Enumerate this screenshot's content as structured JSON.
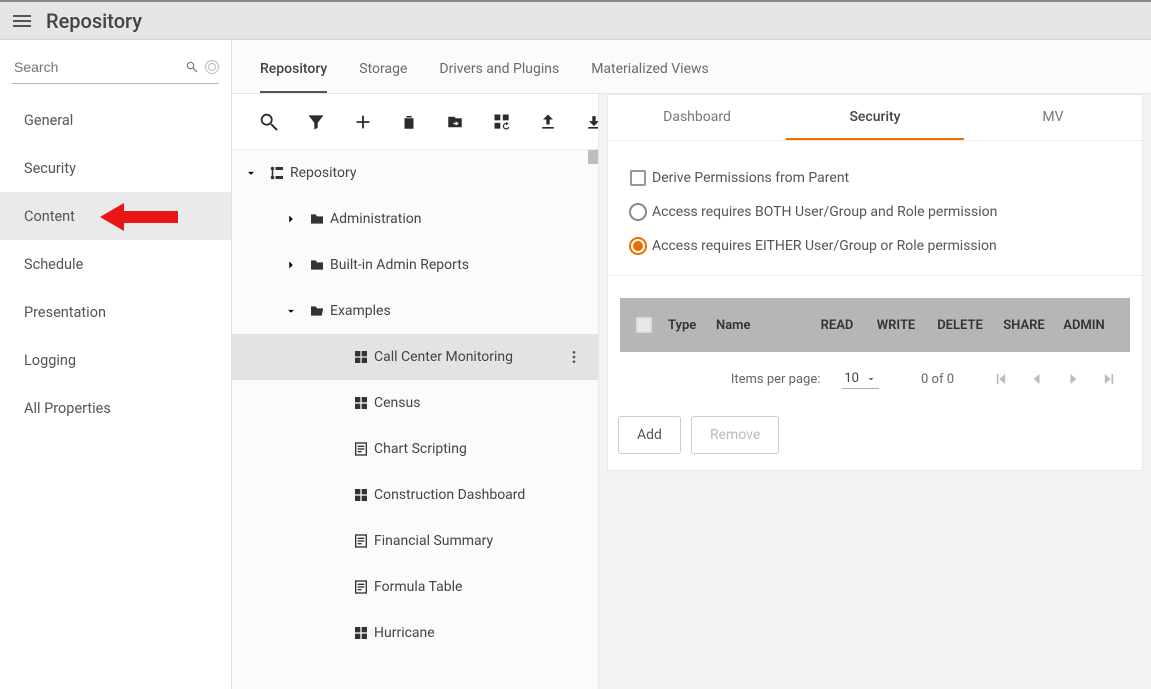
{
  "topbar": {
    "title": "Repository"
  },
  "sidebar": {
    "search_placeholder": "Search",
    "items": [
      {
        "label": "General",
        "active": false
      },
      {
        "label": "Security",
        "active": false
      },
      {
        "label": "Content",
        "active": true
      },
      {
        "label": "Schedule",
        "active": false
      },
      {
        "label": "Presentation",
        "active": false
      },
      {
        "label": "Logging",
        "active": false
      },
      {
        "label": "All Properties",
        "active": false
      }
    ]
  },
  "mid_tabs": {
    "items": [
      {
        "label": "Repository",
        "active": true
      },
      {
        "label": "Storage",
        "active": false
      },
      {
        "label": "Drivers and Plugins",
        "active": false
      },
      {
        "label": "Materialized Views",
        "active": false
      }
    ]
  },
  "tree": {
    "root": {
      "label": "Repository"
    },
    "folders": [
      {
        "label": "Administration",
        "expanded": false
      },
      {
        "label": "Built-in Admin Reports",
        "expanded": false
      },
      {
        "label": "Examples",
        "expanded": true
      }
    ],
    "example_items": [
      {
        "label": "Call Center Monitoring",
        "icon": "dashboard",
        "selected": true
      },
      {
        "label": "Census",
        "icon": "dashboard"
      },
      {
        "label": "Chart Scripting",
        "icon": "sheet"
      },
      {
        "label": "Construction Dashboard",
        "icon": "dashboard"
      },
      {
        "label": "Financial Summary",
        "icon": "sheet"
      },
      {
        "label": "Formula Table",
        "icon": "sheet"
      },
      {
        "label": "Hurricane",
        "icon": "dashboard"
      }
    ]
  },
  "detail_tabs": {
    "items": [
      {
        "label": "Dashboard",
        "active": false
      },
      {
        "label": "Security",
        "active": true
      },
      {
        "label": "MV",
        "active": false
      }
    ]
  },
  "permissions": {
    "derive_label": "Derive Permissions from Parent",
    "option_both": "Access requires BOTH User/Group and Role permission",
    "option_either": "Access requires EITHER User/Group or Role permission",
    "selected": "either",
    "table": {
      "headers": {
        "type": "Type",
        "name": "Name",
        "read": "READ",
        "write": "WRITE",
        "delete": "DELETE",
        "share": "SHARE",
        "admin": "ADMIN"
      },
      "rows": []
    },
    "pager": {
      "items_per_page_label": "Items per page:",
      "page_size": "10",
      "range": "0 of 0"
    },
    "add_label": "Add",
    "remove_label": "Remove"
  },
  "colors": {
    "accent": "#ef6c00"
  }
}
